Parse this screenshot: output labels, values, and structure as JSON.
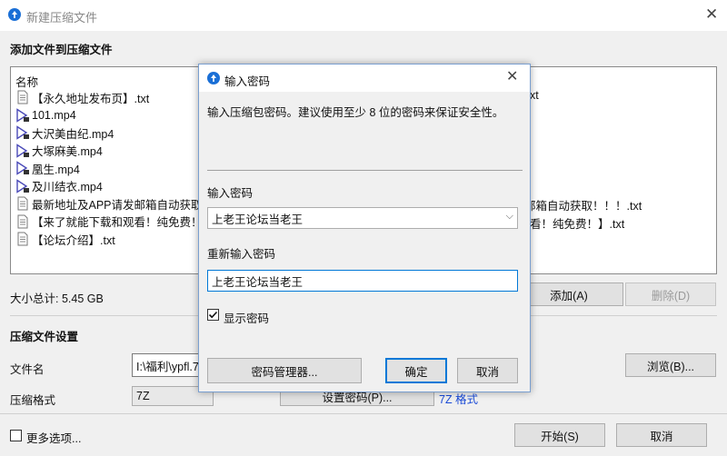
{
  "main_window": {
    "title": "新建压缩文件",
    "section_title": "添加文件到压缩文件",
    "column_name": "名称",
    "files": [
      {
        "name": "【永久地址发布页】.txt",
        "type": "txt"
      },
      {
        "name": "101.mp4",
        "type": "video"
      },
      {
        "name": "大沢美由纪.mp4",
        "type": "video"
      },
      {
        "name": "大塚麻美.mp4",
        "type": "video"
      },
      {
        "name": "凰生.mp4",
        "type": "video"
      },
      {
        "name": "及川结衣.mp4",
        "type": "video"
      },
      {
        "name": "最新地址及APP请发邮箱自动获取",
        "type": "txt"
      },
      {
        "name": "【来了就能下载和观看！纯免费！",
        "type": "txt"
      },
      {
        "name": "【论坛介绍】.txt",
        "type": "txt"
      }
    ],
    "overflow_text": {
      "row1": "xt",
      "row7": "邮箱自动获取！！！.txt",
      "row8": "看！纯免费！】.txt"
    },
    "total_size": "大小总计: 5.45 GB",
    "add_button": "添加(A)",
    "delete_button": "删除(D)",
    "settings_title": "压缩文件设置",
    "filename_label": "文件名",
    "filename_value": "I:\\福利\\ypfl.7",
    "browse_button": "浏览(B)...",
    "format_label": "压缩格式",
    "format_value": "7Z",
    "set_password_button": "设置密码(P)...",
    "format_link": "7Z 格式",
    "more_options": "更多选项...",
    "start_button": "开始(S)",
    "cancel_button": "取消"
  },
  "password_dialog": {
    "title": "输入密码",
    "description": "输入压缩包密码。建议使用至少 8 位的密码来保证安全性。",
    "password_label": "输入密码",
    "password_value": "上老王论坛当老王",
    "confirm_label": "重新输入密码",
    "confirm_value": "上老王论坛当老王",
    "show_password": "显示密码",
    "show_password_checked": true,
    "manager_button": "密码管理器...",
    "ok_button": "确定",
    "cancel_button": "取消"
  },
  "colors": {
    "accent": "#0078d7",
    "app_icon": "#1a6fd6",
    "link": "#1a4ad6"
  }
}
